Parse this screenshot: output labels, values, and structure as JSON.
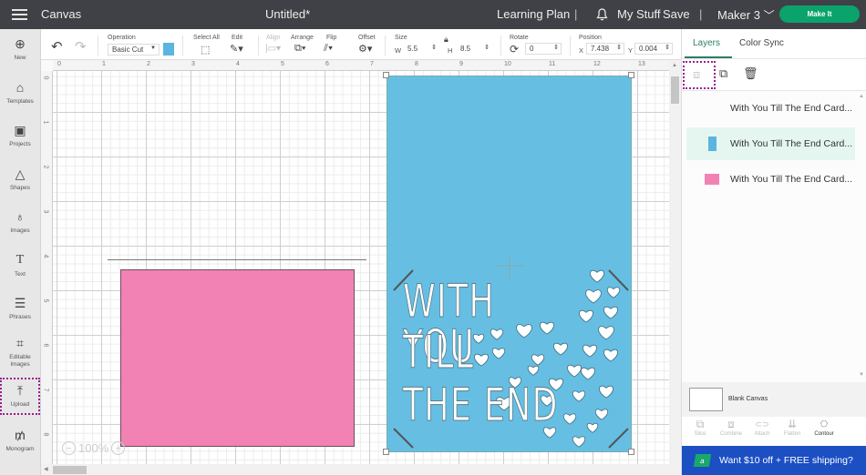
{
  "topbar": {
    "menu_icon": "hamburger-icon",
    "app_title": "Canvas",
    "doc_title": "Untitled*",
    "learning_plan": "Learning Plan",
    "separator": "|",
    "bell_icon": "bell-icon",
    "my_stuff": "My Stuff",
    "save": "Save",
    "machine": "Maker 3",
    "machine_chevron": "⌄",
    "make_it": "Make It"
  },
  "toolbar": {
    "undo_icon": "↶",
    "redo_icon": "↷",
    "operation_label": "Operation",
    "operation_value": "Basic Cut",
    "operation_color": "#5ab5e0",
    "select_all_label": "Select All",
    "edit_label": "Edit",
    "align_label": "Align",
    "arrange_label": "Arrange",
    "flip_label": "Flip",
    "offset_label": "Offset",
    "size_label": "Size",
    "w_label": "W",
    "w_value": "5.5",
    "h_label": "H",
    "h_value": "8.5",
    "rotate_label": "Rotate",
    "rotate_value": "0",
    "position_label": "Position",
    "x_label": "X",
    "x_value": "7.438",
    "y_label": "Y",
    "y_value": "0.004"
  },
  "sidebar": {
    "items": [
      {
        "label": "New",
        "icon": "⊕"
      },
      {
        "label": "Templates",
        "icon": "👕"
      },
      {
        "label": "Projects",
        "icon": "▣"
      },
      {
        "label": "Shapes",
        "icon": "△"
      },
      {
        "label": "Images",
        "icon": "♁"
      },
      {
        "label": "Text",
        "icon": "T"
      },
      {
        "label": "Phrases",
        "icon": "☰"
      },
      {
        "label": "Editable Images",
        "icon": "⌗"
      },
      {
        "label": "Upload",
        "icon": "⤒"
      },
      {
        "label": "Monogram",
        "icon": "₥"
      }
    ]
  },
  "rulers": {
    "h": [
      "0",
      "1",
      "2",
      "3",
      "4",
      "5",
      "6",
      "7",
      "8",
      "9",
      "10",
      "11",
      "12",
      "13"
    ],
    "v": [
      "0",
      "1",
      "2",
      "3",
      "4",
      "5",
      "6",
      "7",
      "8"
    ]
  },
  "canvas": {
    "card_lines": [
      "WITH YOU",
      "TILL",
      "THE END"
    ],
    "pink_color": "#f282b4",
    "blue_color": "#66bfe3",
    "zoom_level": "100%",
    "zoom_out": "−",
    "zoom_in": "+"
  },
  "panel": {
    "tabs": [
      {
        "label": "Layers"
      },
      {
        "label": "Color Sync"
      }
    ],
    "layers": [
      {
        "name": "With You Till The End Card...",
        "color": ""
      },
      {
        "name": "With You Till The End Card...",
        "color": "#5ab5e0"
      },
      {
        "name": "With You Till The End Card...",
        "color": "#f282b4"
      }
    ],
    "blank_canvas": "Blank Canvas",
    "actions": [
      {
        "label": "Slice",
        "icon": "⧉"
      },
      {
        "label": "Combine",
        "icon": "⧈"
      },
      {
        "label": "Attach",
        "icon": "⊂⊃"
      },
      {
        "label": "Flatten",
        "icon": "⇊"
      },
      {
        "label": "Contour",
        "icon": "◌"
      }
    ],
    "promo": "Want $10 off + FREE shipping?",
    "promo_badge": "a"
  }
}
